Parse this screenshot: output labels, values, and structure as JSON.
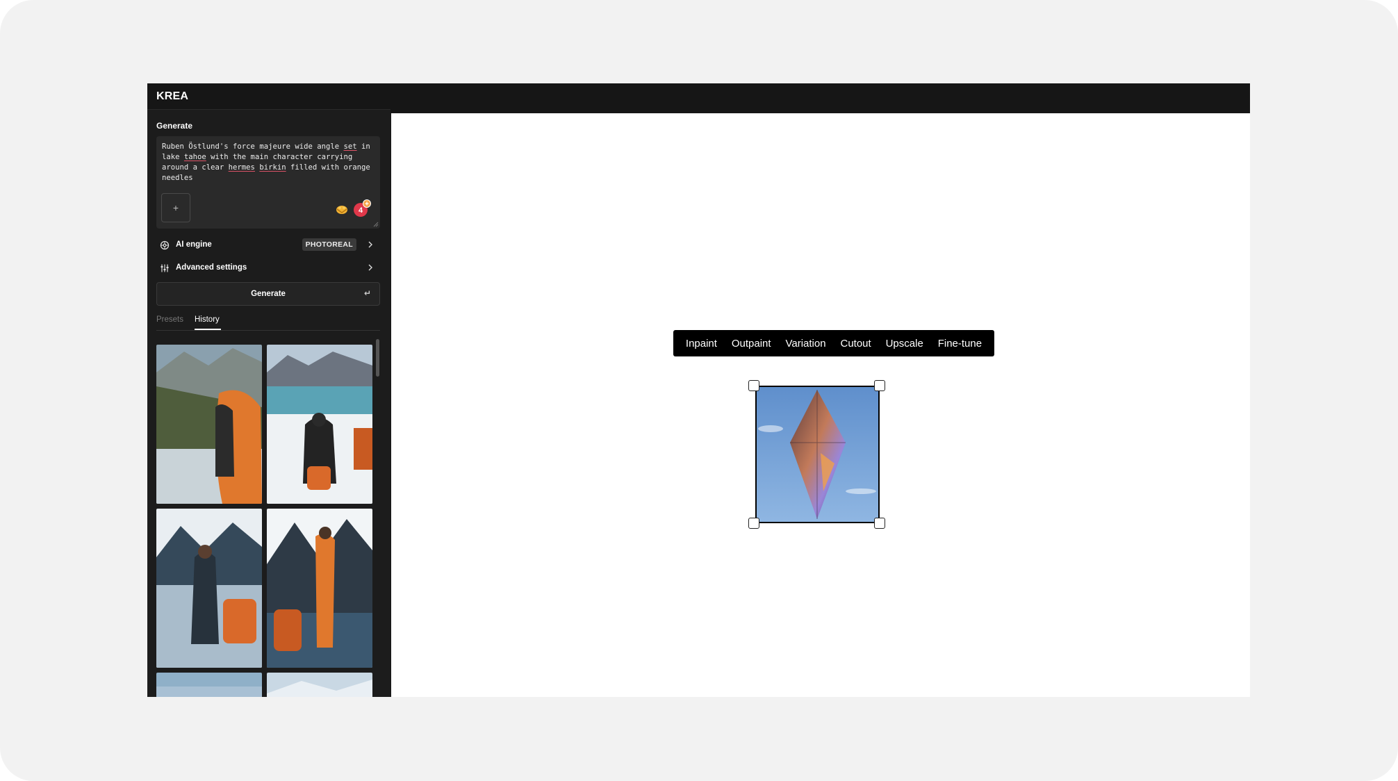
{
  "app": {
    "logo": "KREA"
  },
  "generate": {
    "section_title": "Generate",
    "prompt": {
      "segments": [
        {
          "text": "Ruben Östlund's force majeure wide angle ",
          "underline": false
        },
        {
          "text": "set",
          "underline": true
        },
        {
          "text": " in lake ",
          "underline": false
        },
        {
          "text": "tahoe",
          "underline": true
        },
        {
          "text": " with the main character carrying around a clear ",
          "underline": false
        },
        {
          "text": "hermes",
          "underline": true
        },
        {
          "text": " ",
          "underline": false
        },
        {
          "text": "birkin",
          "underline": true
        },
        {
          "text": " filled with orange needles",
          "underline": false
        }
      ]
    },
    "add_image_label": "+",
    "ai_engine": {
      "label": "AI engine",
      "value": "PHOTOREAL"
    },
    "advanced_settings": {
      "label": "Advanced settings"
    },
    "button_label": "Generate",
    "button_shortcut": "↵"
  },
  "tabs": [
    {
      "label": "Presets",
      "active": false
    },
    {
      "label": "History",
      "active": true
    }
  ],
  "history": {
    "thumbnails": [
      {
        "icon": "history-thumbnail"
      },
      {
        "icon": "history-thumbnail"
      },
      {
        "icon": "history-thumbnail"
      },
      {
        "icon": "history-thumbnail"
      },
      {
        "icon": "history-thumbnail"
      },
      {
        "icon": "history-thumbnail"
      }
    ]
  },
  "canvas_toolbar": {
    "items": [
      "Inpaint",
      "Outpaint",
      "Variation",
      "Cutout",
      "Upscale",
      "Fine-tune"
    ]
  },
  "colors": {
    "accent_underline": "#e05468",
    "sidebar_bg": "#1c1c1c",
    "canvas_bg": "#ffffff",
    "badge_red": "#e0384a"
  }
}
